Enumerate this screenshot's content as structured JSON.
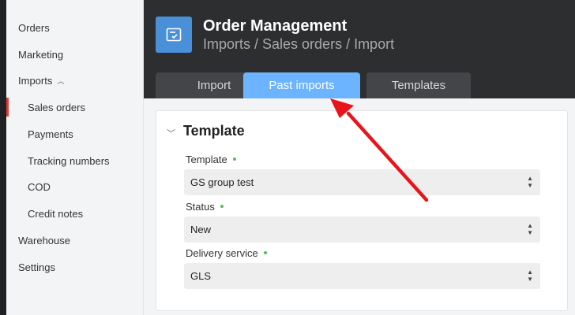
{
  "sidebar": {
    "items": [
      {
        "label": "Orders"
      },
      {
        "label": "Marketing"
      },
      {
        "label": "Imports"
      },
      {
        "label": "Sales orders"
      },
      {
        "label": "Payments"
      },
      {
        "label": "Tracking numbers"
      },
      {
        "label": "COD"
      },
      {
        "label": "Credit notes"
      },
      {
        "label": "Warehouse"
      },
      {
        "label": "Settings"
      }
    ],
    "active_item": "Sales orders",
    "accent_color": "#e53935"
  },
  "header": {
    "title": "Order Management",
    "breadcrumb": "Imports / Sales orders / Import",
    "icon": "document-check-icon",
    "icon_color": "#4a90d9"
  },
  "tabs": [
    {
      "label": "Import",
      "active": false
    },
    {
      "label": "Past imports",
      "active": true
    },
    {
      "label": "Templates",
      "active": false
    }
  ],
  "template_section": {
    "title": "Template",
    "fields": [
      {
        "label": "Template",
        "value": "GS group test"
      },
      {
        "label": "Status",
        "value": "New"
      },
      {
        "label": "Delivery service",
        "value": "GLS"
      }
    ]
  },
  "annotation": {
    "type": "arrow",
    "color": "#e8141b",
    "target": "Past imports"
  }
}
